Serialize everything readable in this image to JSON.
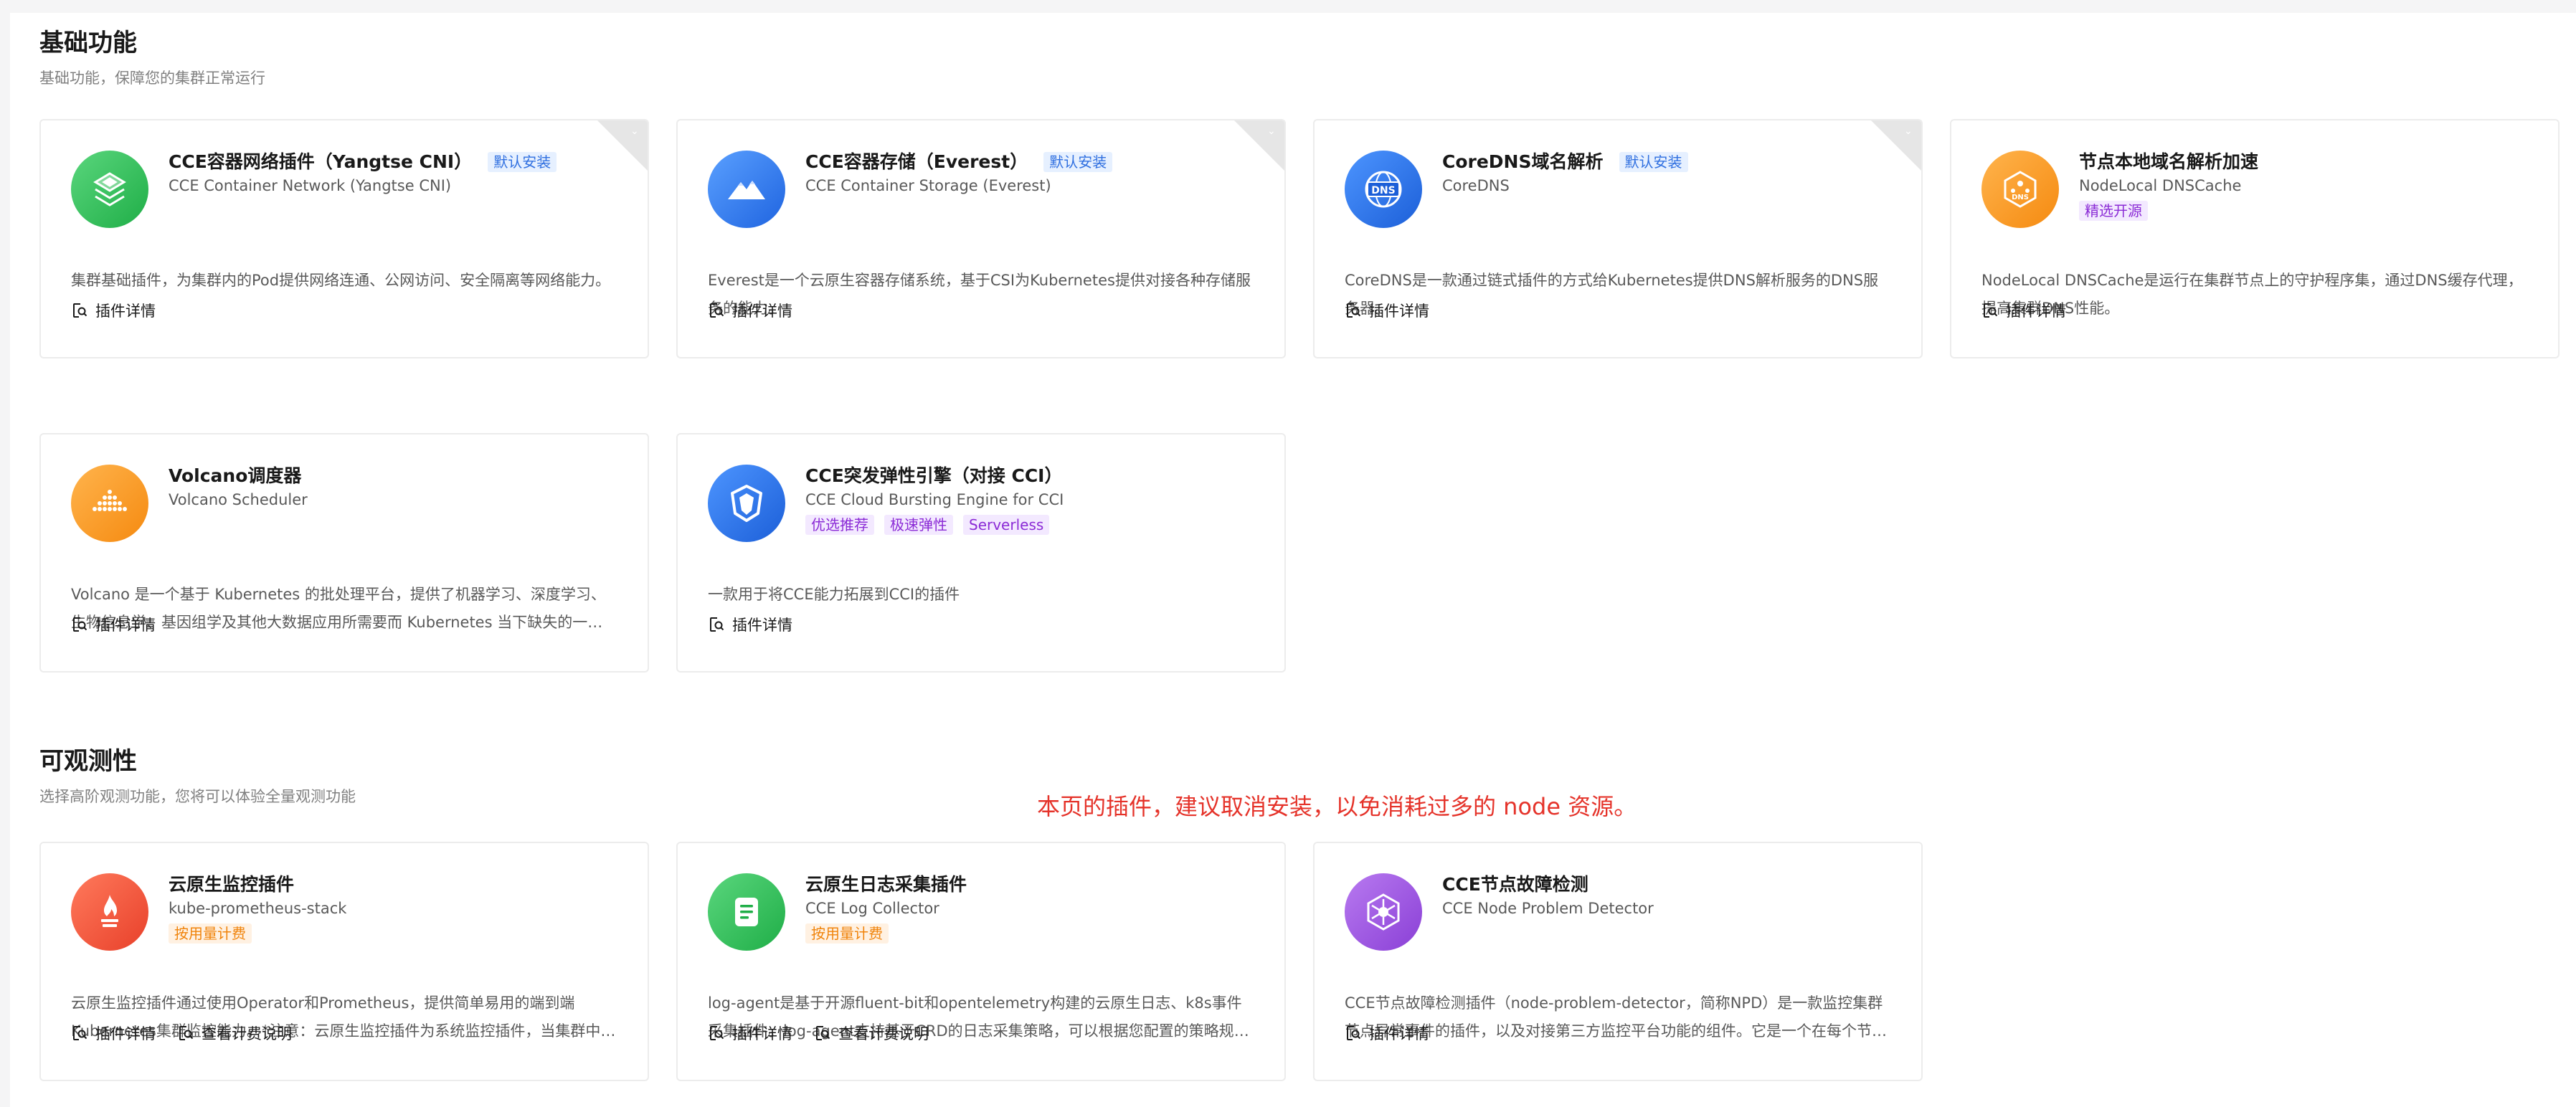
{
  "sections": {
    "basic": {
      "title": "基础功能",
      "desc": "基础功能，保障您的集群正常运行"
    },
    "observability": {
      "title": "可观测性",
      "desc": "选择高阶观测功能，您将可以体验全量观测功能"
    }
  },
  "notice": "本页的插件，建议取消安装，以免消耗过多的 node 资源。",
  "labels": {
    "details": "插件详情",
    "billing": "查看计费说明"
  },
  "cards": [
    {
      "name": "CCE容器网络插件（Yangtse CNI）",
      "sub": "CCE Container Network (Yangtse CNI)",
      "badge": "默认安装",
      "desc": "集群基础插件，为集群内的Pod提供网络连通、公网访问、安全隔离等网络能力。",
      "icon": "network-plugin-icon",
      "color": "#2fbf55"
    },
    {
      "name": "CCE容器存储（Everest）",
      "sub": "CCE Container Storage (Everest)",
      "badge": "默认安装",
      "desc": "Everest是一个云原生容器存储系统，基于CSI为Kubernetes提供对接各种存储服务的能力。",
      "icon": "mountain-icon",
      "color": "#2f7cf0"
    },
    {
      "name": "CoreDNS域名解析",
      "sub": "CoreDNS",
      "badge": "默认安装",
      "desc": "CoreDNS是一款通过链式插件的方式给Kubernetes提供DNS解析服务的DNS服务器。",
      "icon": "dns-globe-icon",
      "color": "#2f7cf0"
    },
    {
      "name": "节点本地域名解析加速",
      "sub": "NodeLocal DNSCache",
      "tags": [
        "精选开源"
      ],
      "desc": "NodeLocal DNSCache是运行在集群节点上的守护程序集，通过DNS缓存代理，提高集群DNS性能。",
      "icon": "dns-hexagon-icon",
      "color": "#fa9a2a"
    },
    {
      "name": "Volcano调度器",
      "sub": "Volcano Scheduler",
      "desc": "Volcano 是一个基于 Kubernetes 的批处理平台，提供了机器学习、深度学习、生物信息学、基因组学及其他大数据应用所需要而 Kubernetes 当下缺失的一系列特性。",
      "icon": "volcano-icon",
      "color": "#fa9a2a"
    },
    {
      "name": "CCE突发弹性引擎（对接 CCI）",
      "sub": "CCE Cloud Bursting Engine for CCI",
      "tags": [
        "优选推荐",
        "极速弹性",
        "Serverless"
      ],
      "desc": "一款用于将CCE能力拓展到CCI的插件",
      "icon": "shield-icon",
      "color": "#2f7cf0"
    },
    {
      "name": "云原生监控插件",
      "sub": "kube-prometheus-stack",
      "tags": [
        "按用量计费"
      ],
      "desc": "云原生监控插件通过使用Operator和Prometheus，提供简单易用的端到端Kubernetes集群监控能力。*注意：云原生监控插件为系统监控插件，当集群中已安装其他监控插件时，请谨慎安装。",
      "icon": "prometheus-flame-icon",
      "color": "#f2553d"
    },
    {
      "name": "云原生日志采集插件",
      "sub": "CCE Log Collector",
      "tags": [
        "按用量计费"
      ],
      "desc": "log-agent是基于开源fluent-bit和opentelemetry构建的云原生日志、k8s事件采集插件。log-agent支持基于CRD的日志采集策略，可以根据您配置的策略规则，对集群中的日志进行采集和转发。",
      "icon": "log-document-icon",
      "color": "#2fbf55"
    },
    {
      "name": "CCE节点故障检测",
      "sub": "CCE Node Problem Detector",
      "desc": "CCE节点故障检测插件（node-problem-detector，简称NPD）是一款监控集群节点异常事件的插件，以及对接第三方监控平台功能的组件。它是一个在每个节点上运行的守护程序。",
      "icon": "node-detector-icon",
      "color": "#a05ae0"
    }
  ]
}
